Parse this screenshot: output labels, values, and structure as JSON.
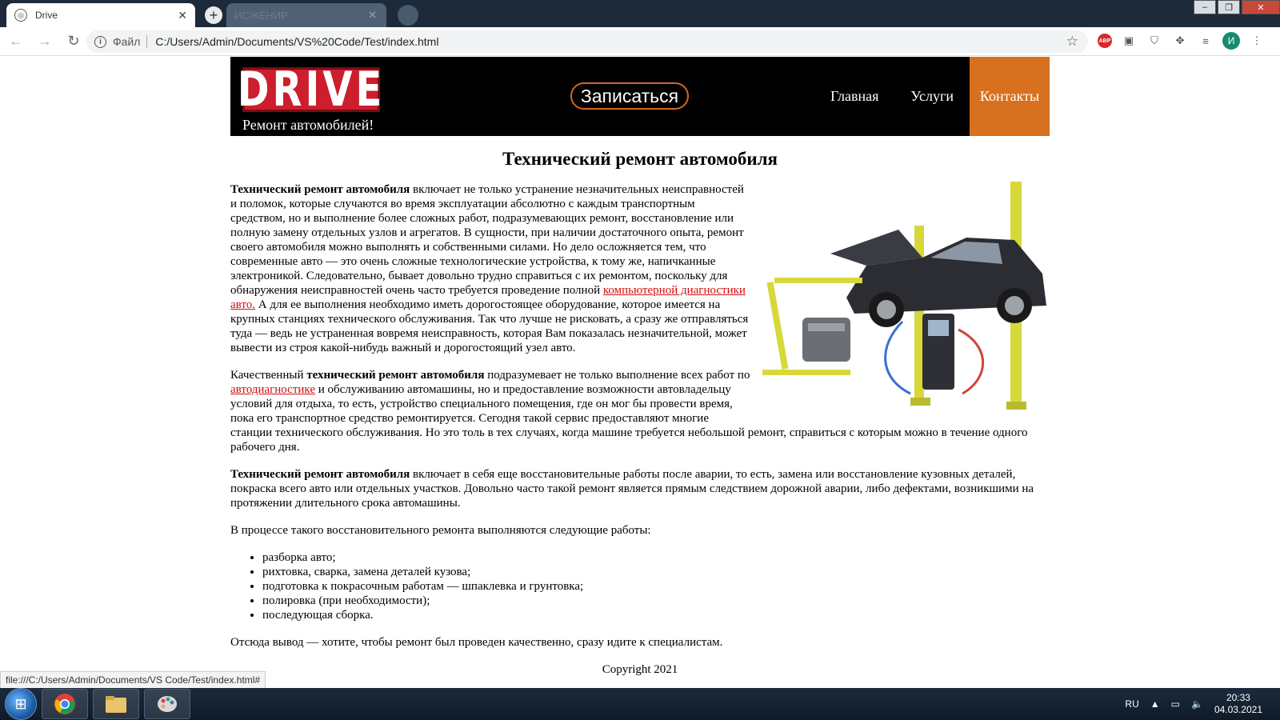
{
  "browser": {
    "active_tab_title": "Drive",
    "inactive_tab_title": "ИСЖЕНИР",
    "scheme_label": "Файл",
    "url": "C:/Users/Admin/Documents/VS%20Code/Test/index.html",
    "profile_initial": "И",
    "abp_label": "ABP",
    "status_url": "file:///C:/Users/Admin/Documents/VS Code/Test/index.html#"
  },
  "site": {
    "logo_text": "DRIVE",
    "tagline": "Ремонт автомобилей!",
    "signup_label": "Записаться",
    "nav": [
      "Главная",
      "Услуги",
      "Контакты"
    ],
    "title": "Технический ремонт автомобиля",
    "p1": {
      "bold": "Технический ремонт автомобиля",
      "text1": " включает не только устранение незначительных неисправностей и поломок, которые случаются во время эксплуатации абсолютно с каждым транспортным средством, но и выполнение более сложных работ, подразумевающих ремонт, восстановление или полную замену отдельных узлов и агрегатов. В сущности, при наличии достаточного опыта, ремонт своего автомобиля можно выполнять и собственными силами. Но дело осложняется тем, что современные авто — это очень сложные технологические устройства, к тому же, напичканные электроникой. Следовательно, бывает довольно трудно справиться с их ремонтом, поскольку для обнаружения неисправностей очень часто требуется проведение полной ",
      "link": "компьютерной диагностики авто.",
      "text2": " А для ее выполнения необходимо иметь дорогостоящее оборудование, которое имеется на крупных станциях технического обслуживания. Так что лучше не рисковать, а сразу же отправляться туда — ведь не устраненная вовремя неисправность, которая Вам показалась незначительной, может вывести из строя какой-нибудь важный и дорогостоящий узел авто."
    },
    "p2": {
      "text0": "Качественный ",
      "bold": "технический ремонт автомобиля",
      "text1": " подразумевает не только выполнение всех работ по ",
      "link": "автодиагностике",
      "text2": " и обслуживанию автомашины, но и предоставление возможности автовладельцу условий для отдыха, то есть, устройство специального помещения, где он мог бы провести время, пока его транспортное средство ремонтируется. Сегодня такой сервис предоставляют многие станции технического обслуживания. Но это толь в тех случаях, когда машине требуется небольшой ремонт, справиться с которым можно в течение одного рабочего дня."
    },
    "p3": {
      "bold": "Технический ремонт автомобиля",
      "text1": " включает в себя еще восстановительные работы после аварии, то есть, замена или восстановление кузовных деталей, покраска всего авто или отдельных участков. Довольно часто такой ремонт является прямым следствием дорожной аварии, либо дефектами, возникшими на протяжении длительного срока автомашины."
    },
    "p4": "В процессе такого восстановительного ремонта выполняются следующие работы:",
    "list": [
      "разборка авто;",
      "рихтовка, сварка, замена деталей кузова;",
      "подготовка к покрасочным работам — шпаклевка и грунтовка;",
      "полировка (при необходимости);",
      "последующая сборка."
    ],
    "p5": "Отсюда вывод — хотите, чтобы ремонт был проведен качественно, сразу идите к специалистам.",
    "copyright": "Copyright 2021"
  },
  "taskbar": {
    "lang": "RU",
    "time": "20:33",
    "date": "04.03.2021"
  },
  "colors": {
    "accent": "#d8711f",
    "logo_red": "#cc1e2c",
    "link": "#d01010"
  }
}
